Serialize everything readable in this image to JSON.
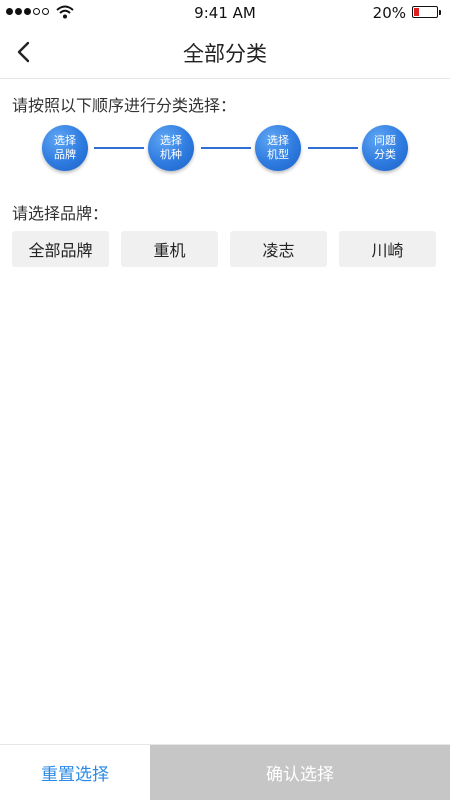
{
  "status_bar": {
    "time": "9:41 AM",
    "battery": "20%",
    "signal_icon": "signal-dots-icon",
    "wifi_icon": "wifi-icon",
    "battery_icon": "battery-low-icon",
    "battery_color": "#e02020"
  },
  "nav": {
    "title": "全部分类",
    "back_icon": "chevron-left-icon"
  },
  "instruction": "请按照以下顺序进行分类选择：",
  "steps": [
    {
      "line1": "选择",
      "line2": "品牌"
    },
    {
      "line1": "选择",
      "line2": "机种"
    },
    {
      "line1": "选择",
      "line2": "机型"
    },
    {
      "line1": "问题",
      "line2": "分类"
    }
  ],
  "brand_section": {
    "label": "请选择品牌：",
    "options": [
      "全部品牌",
      "重机",
      "凌志",
      "川崎"
    ]
  },
  "bottom": {
    "reset_label": "重置选择",
    "confirm_label": "确认选择",
    "accent_color": "#2a8ae6",
    "disabled_color": "#c6c6c6"
  }
}
